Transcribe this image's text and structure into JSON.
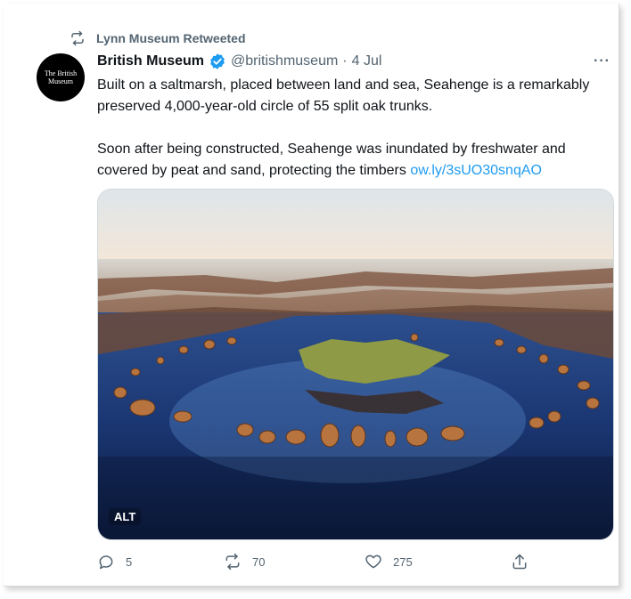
{
  "retweeted_by": "Lynn Museum Retweeted",
  "author": {
    "avatar_text_line1": "The British",
    "avatar_text_line2": "Museum",
    "name": "British Museum",
    "handle": "@britishmuseum",
    "separator": "·",
    "date": "4 Jul"
  },
  "more_label": "···",
  "tweet": {
    "paragraph1": "Built on a saltmarsh, placed between land and sea, Seahenge is a remarkably preserved 4,000-year-old circle of 55 split oak trunks.",
    "paragraph2": "Soon after being constructed, Seahenge was inundated by freshwater and covered by peat and sand, protecting the timbers",
    "link": "ow.ly/3sUO30snqAO"
  },
  "media": {
    "alt_label": "ALT"
  },
  "actions": {
    "replies": "5",
    "retweets": "70",
    "likes": "275"
  },
  "icons": {
    "retweet": "retweet-icon",
    "verified": "verified-badge-icon",
    "reply": "reply-icon",
    "like": "heart-icon",
    "share": "share-icon"
  },
  "colors": {
    "accent": "#1d9bf0",
    "secondary_text": "#536471"
  }
}
